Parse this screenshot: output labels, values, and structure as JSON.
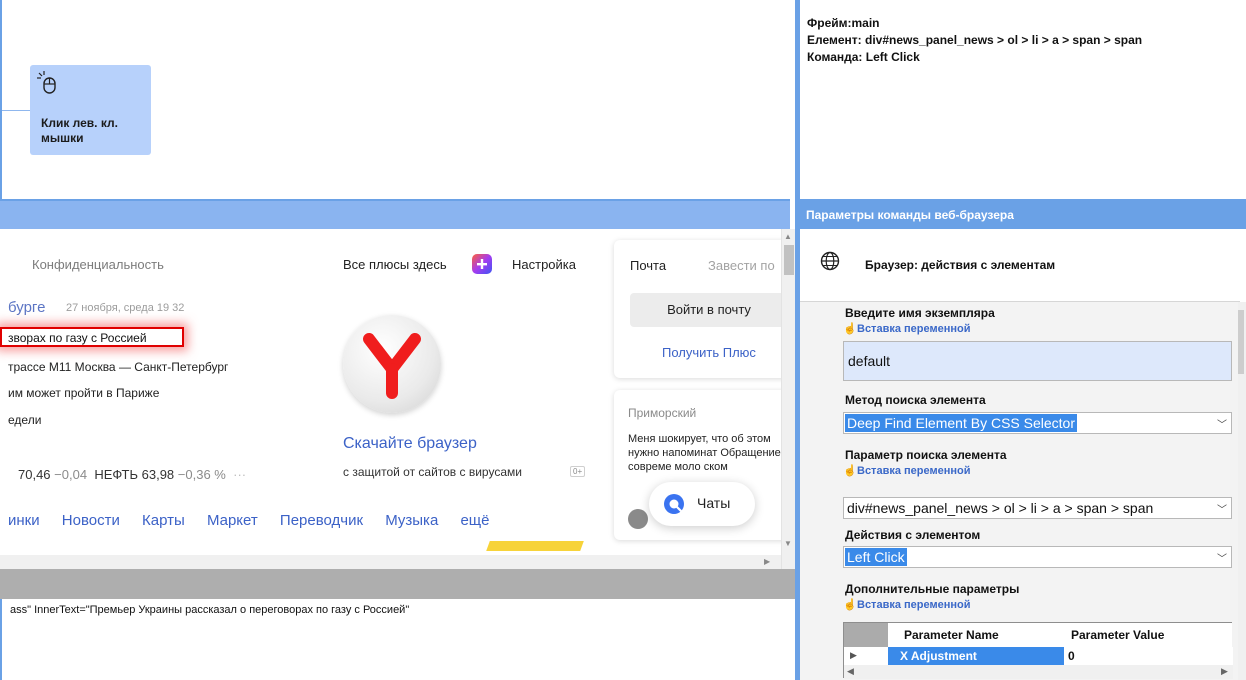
{
  "workflow": {
    "block_label": "Клик лев. кл. мышки"
  },
  "webpage": {
    "nav_privacy": "Конфиденциальность",
    "nav_plus": "Все плюсы здесь",
    "nav_settings": "Настройка",
    "city": "бурге",
    "date": "27 ноября, среда 19 32",
    "news": [
      "зворах по газу с Россией",
      "трассе М11 Москва — Санкт-Петербург",
      "им может пройти в Париже",
      "едели"
    ],
    "quotes": {
      "value1": "70,46",
      "change1": "−0,04",
      "oil_label": "НЕФТЬ",
      "value2": "63,98",
      "change2": "−0,36 %",
      "more": "···"
    },
    "services": [
      "инки",
      "Новости",
      "Карты",
      "Маркет",
      "Переводчик",
      "Музыка",
      "ещё"
    ],
    "download_title": "Скачайте браузер",
    "download_sub": "с защитой от сайтов с вирусами",
    "age_badge": "0+",
    "mail": {
      "label": "Почта",
      "create": "Завести по",
      "login_button": "Войти в почту",
      "get_plus": "Получить Плюс"
    },
    "zen": {
      "location": "Приморский",
      "text": "Меня шокирует, что об этом нужно напоминат Обращение к совреме моло              ском"
    },
    "chats_label": "Чаты"
  },
  "properties_text": "ass\" InnerText=\"Премьер Украины рассказал о переговорах по газу с Россией\"",
  "info": {
    "frame": "Фрейм:main",
    "element": "Елемент: div#news_panel_news > ol > li > a > span > span",
    "command": "Команда: Left Click"
  },
  "params": {
    "header": "Параметры команды веб-браузера",
    "browser_title": "Браузер: действия с элементам",
    "var_insert": "Вставка переменной",
    "instance_label": "Введите имя экземпляра",
    "instance_value": "default",
    "method_label": "Метод поиска элемента",
    "method_value": "Deep Find Element By CSS Selector",
    "search_param_label": "Параметр поиска элемента",
    "search_param_value": "div#news_panel_news > ol > li > a > span > span",
    "action_label": "Действия с элементом",
    "action_value": "Left Click",
    "extra_label": "Дополнительные параметры",
    "grid": {
      "col1": "Parameter Name",
      "col2": "Parameter Value",
      "row1_name": "X Adjustment",
      "row1_value": "0"
    }
  },
  "colors": {
    "accent": "#6aa1e6",
    "selection": "#3a8ae9",
    "link": "#3c62c7",
    "highlight": "#e00000"
  }
}
